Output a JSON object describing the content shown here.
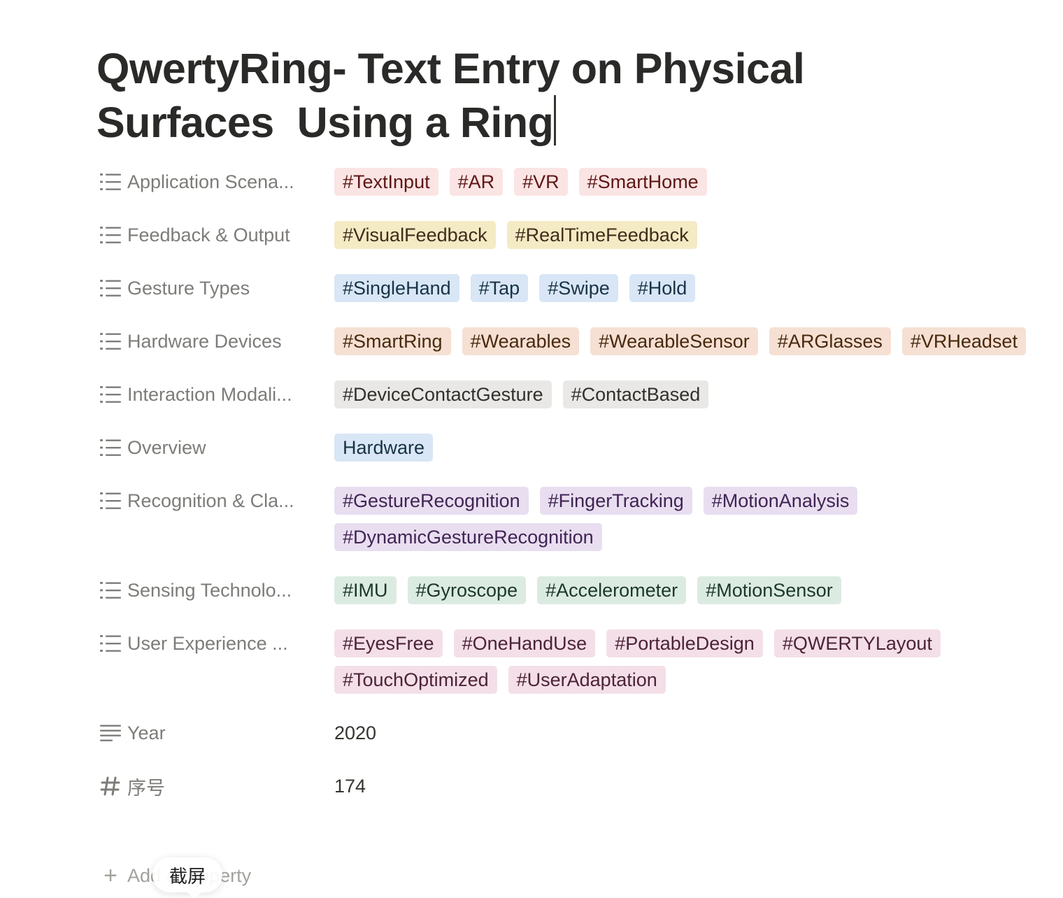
{
  "title": "QwertyRing- Text Entry on Physical Surfaces  Using a Ring",
  "tag_colors": {
    "red": "#fbe4e4",
    "yellow": "#f4eac4",
    "blue": "#d8e6f6",
    "orange": "#f5e0d3",
    "gray": "#e9e8e6",
    "purple": "#e8def0",
    "green": "#dcebe2",
    "pink": "#f4dfe8"
  },
  "properties": [
    {
      "name": "Application Scena...",
      "icon": "list-icon",
      "color": "red",
      "tags": [
        "#TextInput",
        "#AR",
        "#VR",
        "#SmartHome"
      ]
    },
    {
      "name": "Feedback & Output",
      "icon": "list-icon",
      "color": "yellow",
      "tags": [
        "#VisualFeedback",
        "#RealTimeFeedback"
      ]
    },
    {
      "name": "Gesture Types",
      "icon": "list-icon",
      "color": "blue",
      "tags": [
        "#SingleHand",
        "#Tap",
        "#Swipe",
        "#Hold"
      ]
    },
    {
      "name": "Hardware Devices",
      "icon": "list-icon",
      "color": "orange",
      "tags": [
        "#SmartRing",
        "#Wearables",
        "#WearableSensor",
        "#ARGlasses",
        "#VRHeadset"
      ]
    },
    {
      "name": "Interaction Modali...",
      "icon": "list-icon",
      "color": "gray",
      "tags": [
        "#DeviceContactGesture",
        "#ContactBased"
      ]
    },
    {
      "name": "Overview",
      "icon": "list-icon",
      "color": "blue",
      "tags": [
        "Hardware"
      ]
    },
    {
      "name": "Recognition & Cla...",
      "icon": "list-icon",
      "color": "purple",
      "tags": [
        "#GestureRecognition",
        "#FingerTracking",
        "#MotionAnalysis",
        "#DynamicGestureRecognition"
      ]
    },
    {
      "name": "Sensing Technolo...",
      "icon": "list-icon",
      "color": "green",
      "tags": [
        "#IMU",
        "#Gyroscope",
        "#Accelerometer",
        "#MotionSensor"
      ]
    },
    {
      "name": "User Experience ...",
      "icon": "list-icon",
      "color": "pink",
      "tags": [
        "#EyesFree",
        "#OneHandUse",
        "#PortableDesign",
        "#QWERTYLayout",
        "#TouchOptimized",
        "#UserAdaptation"
      ]
    }
  ],
  "year": {
    "name": "Year",
    "icon": "text-lines-icon",
    "value": "2020"
  },
  "serial": {
    "name": "序号",
    "icon": "hash-icon",
    "value": "174"
  },
  "add_property": {
    "icon": "plus-icon",
    "label": "Add a property"
  },
  "tooltip": {
    "label": "截屏"
  }
}
